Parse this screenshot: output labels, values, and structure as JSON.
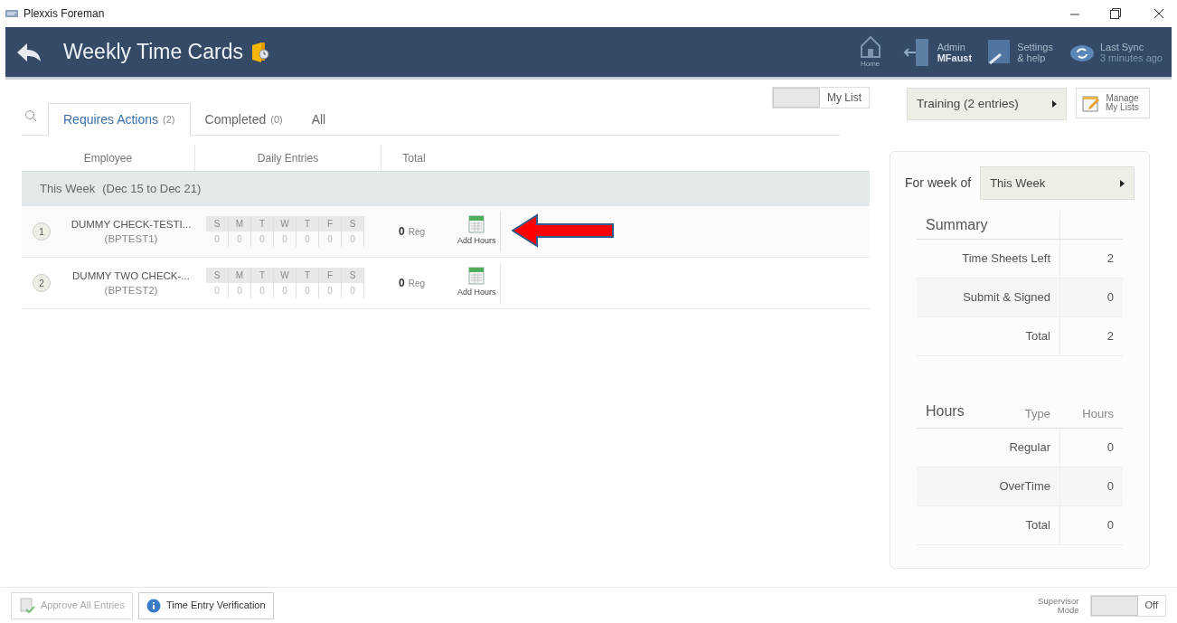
{
  "window": {
    "title": "Plexxis Foreman"
  },
  "header": {
    "title": "Weekly Time Cards",
    "home": "Home",
    "user": {
      "role": "Admin",
      "name": "MFaust"
    },
    "settings": {
      "line1": "Settings",
      "line2": "& help"
    },
    "sync": {
      "label": "Last Sync",
      "time": "3 minutes ago"
    }
  },
  "toolbar": {
    "my_list": {
      "label": "My List",
      "on": false
    },
    "list_select": "Training (2 entries)",
    "manage": {
      "line1": "Manage",
      "line2": "My Lists"
    }
  },
  "tabs": [
    {
      "label": "Requires Actions",
      "count": "(2)",
      "selected": true
    },
    {
      "label": "Completed",
      "count": "(0)",
      "selected": false
    },
    {
      "label": "All",
      "selected": false
    }
  ],
  "table": {
    "columns": [
      "Employee",
      "Daily Entries",
      "Total"
    ],
    "group": {
      "label": "This Week",
      "range": "(Dec 15 to Dec 21)"
    },
    "rows": [
      {
        "number": "1",
        "name": "DUMMY CHECK-TESTI...",
        "code": "(BPTEST1)",
        "days": [
          {
            "day": "S",
            "value": "0"
          },
          {
            "day": "M",
            "value": "0"
          },
          {
            "day": "T",
            "value": "0"
          },
          {
            "day": "W",
            "value": "0"
          },
          {
            "day": "T",
            "value": "0"
          },
          {
            "day": "F",
            "value": "0"
          },
          {
            "day": "S",
            "value": "0"
          }
        ],
        "total": "0",
        "total_unit": "Reg",
        "action": "Add Hours",
        "pointed": true
      },
      {
        "number": "2",
        "name": "DUMMY TWO CHECK-...",
        "code": "(BPTEST2)",
        "days": [
          {
            "day": "S",
            "value": "0"
          },
          {
            "day": "M",
            "value": "0"
          },
          {
            "day": "T",
            "value": "0"
          },
          {
            "day": "W",
            "value": "0"
          },
          {
            "day": "T",
            "value": "0"
          },
          {
            "day": "F",
            "value": "0"
          },
          {
            "day": "S",
            "value": "0"
          }
        ],
        "total": "0",
        "total_unit": "Reg",
        "action": "Add Hours",
        "pointed": false
      }
    ]
  },
  "side_panel": {
    "week_label": "For week of",
    "week_select": "This Week",
    "summary": {
      "title": "Summary",
      "rows": [
        {
          "label": "Time Sheets Left",
          "value": "2"
        },
        {
          "label": "Submit & Signed",
          "value": "0"
        },
        {
          "label": "Total",
          "value": "2"
        }
      ]
    },
    "hours": {
      "title": "Hours",
      "type_header": "Type",
      "hours_header": "Hours",
      "rows": [
        {
          "label": "Regular",
          "value": "0"
        },
        {
          "label": "OverTime",
          "value": "0"
        },
        {
          "label": "Total",
          "value": "0"
        }
      ]
    }
  },
  "footer": {
    "approve": {
      "label": "Approve All Entries",
      "disabled": true
    },
    "verify": {
      "label": "Time Entry Verification"
    },
    "supervisor": {
      "label_1": "Supervisor",
      "label_2": "Mode",
      "state": "Off",
      "on": false
    }
  }
}
